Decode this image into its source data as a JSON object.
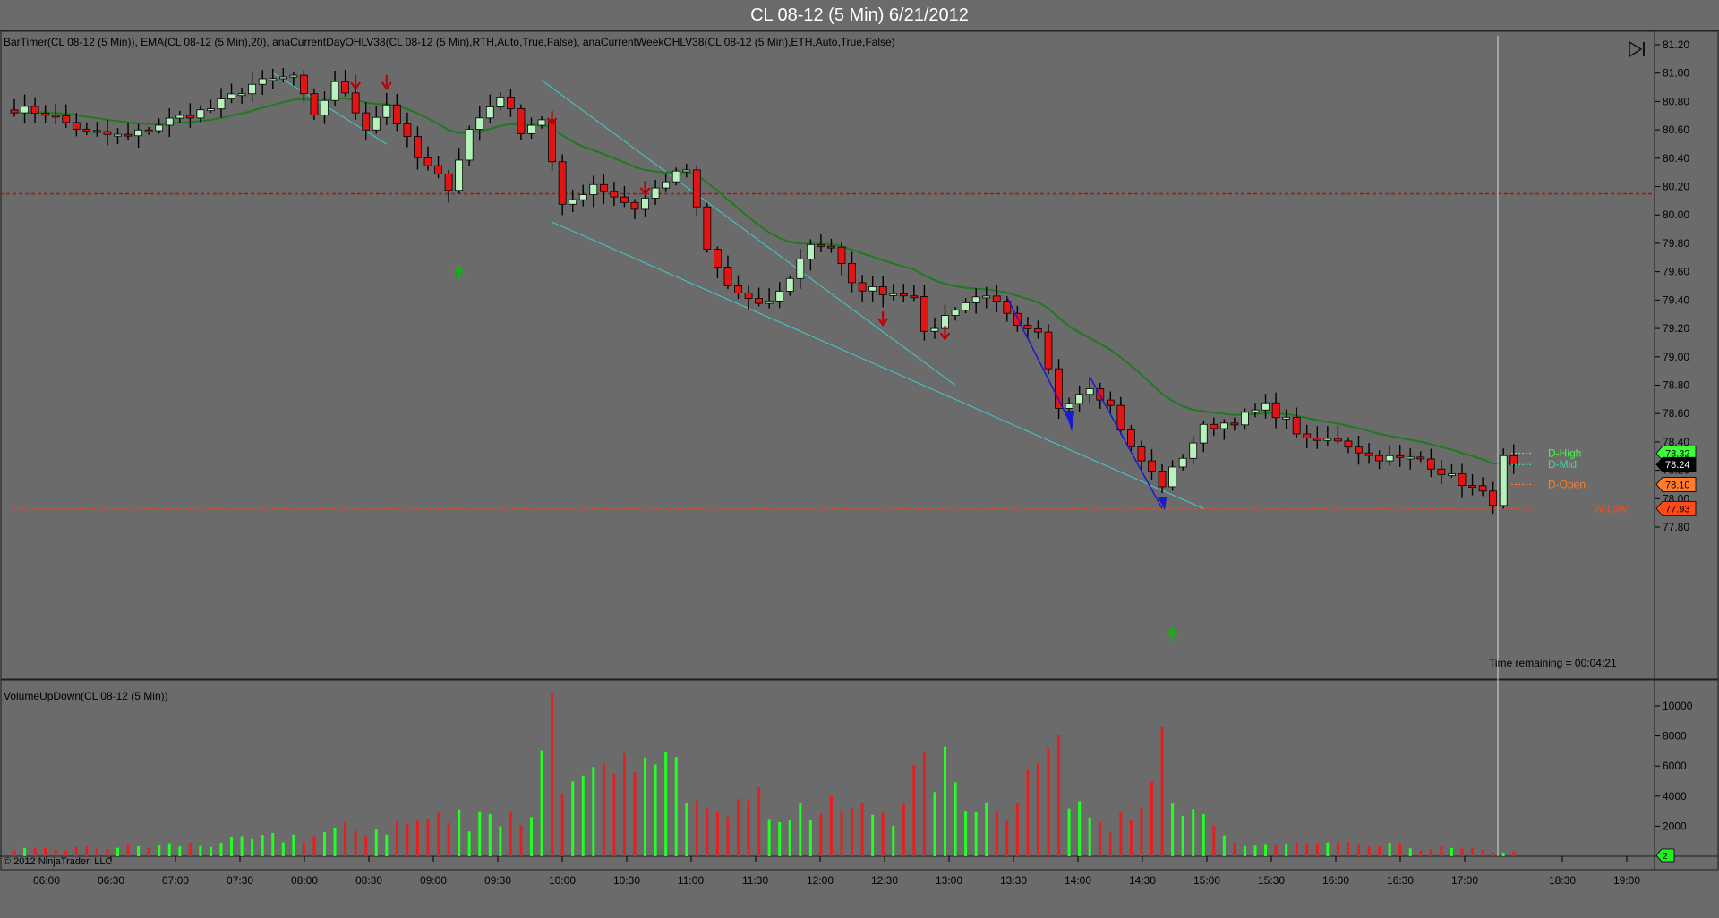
{
  "window": {
    "title": "CL 08-12 (5 Min)  6/21/2012"
  },
  "indicators": {
    "label": "BarTimer(CL  08-12  (5  Min)),  EMA(CL  08-12  (5  Min),20),  anaCurrentDayOHLV38(CL  08-12  (5  Min),RTH,Auto,True,False),  anaCurrentWeekOHLV38(CL  08-12  (5  Min),ETH,Auto,True,False)",
    "volume_label": "VolumeUpDown(CL 08-12 (5 Min))"
  },
  "timer": {
    "text": "Time remaining = 00:04:21"
  },
  "copyright": "© 2012 NinjaTrader, LLC",
  "colors": {
    "up": "#b7f2bd",
    "down": "#e31414",
    "ema": "#1e7a1e",
    "channel": "#3ecece",
    "vol_up": "#22ff22",
    "vol_down": "#e62020",
    "bg": "#6b6b6b",
    "level_red": "#b01010",
    "w_low": "#ff4a1a"
  },
  "levels": [
    {
      "name": "D-High",
      "value": 78.32,
      "tag": "78.32",
      "color": "#3bff3b"
    },
    {
      "name": "D-Mid",
      "value": 78.24,
      "tag": "78.24",
      "color": "#3fd8a8"
    },
    {
      "name": "D-Open",
      "value": 78.1,
      "tag": "78.10",
      "color": "#ff7b2e"
    },
    {
      "name": "W-Low",
      "value": 77.93,
      "tag": "77.93",
      "color": "#ff4a1a"
    }
  ],
  "chart_data": {
    "type": "candlestick",
    "title": "CL 08-12 (5 Min)  6/21/2012",
    "price_axis": {
      "ticks": [
        "81.20",
        "81.00",
        "80.80",
        "80.60",
        "80.40",
        "80.20",
        "80.00",
        "79.80",
        "79.60",
        "79.40",
        "79.20",
        "79.00",
        "78.80",
        "78.60",
        "78.40",
        "78.20",
        "78.00",
        "77.80"
      ],
      "range": [
        77.72,
        81.3
      ]
    },
    "volume_axis": {
      "ticks": [
        "10000",
        "8000",
        "6000",
        "4000",
        "2000"
      ],
      "range": [
        0,
        11500
      ]
    },
    "time_axis": [
      "06:00",
      "06:30",
      "07:00",
      "07:30",
      "08:00",
      "08:30",
      "09:00",
      "09:30",
      "10:00",
      "10:30",
      "11:00",
      "11:30",
      "12:00",
      "12:30",
      "13:00",
      "13:30",
      "14:00",
      "14:30",
      "15:00",
      "15:30",
      "16:00",
      "16:30",
      "17:00",
      "18:30",
      "19:00"
    ],
    "red_dashed_level": 80.15,
    "w_low_level": 77.93,
    "anchors": [
      {
        "b": 0,
        "p": 80.75
      },
      {
        "b": 3,
        "p": 80.72
      },
      {
        "b": 7,
        "p": 80.58
      },
      {
        "b": 11,
        "p": 80.55
      },
      {
        "b": 15,
        "p": 80.67
      },
      {
        "b": 19,
        "p": 80.75
      },
      {
        "b": 23,
        "p": 80.92
      },
      {
        "b": 27,
        "p": 80.98
      },
      {
        "b": 29,
        "p": 80.68
      },
      {
        "b": 31,
        "p": 80.95
      },
      {
        "b": 34,
        "p": 80.62
      },
      {
        "b": 36,
        "p": 80.78
      },
      {
        "b": 39,
        "p": 80.4
      },
      {
        "b": 42,
        "p": 80.2
      },
      {
        "b": 44,
        "p": 80.6
      },
      {
        "b": 47,
        "p": 80.85
      },
      {
        "b": 49,
        "p": 80.6
      },
      {
        "b": 51,
        "p": 80.68
      },
      {
        "b": 53,
        "p": 80.05
      },
      {
        "b": 56,
        "p": 80.22
      },
      {
        "b": 60,
        "p": 80.05
      },
      {
        "b": 63,
        "p": 80.25
      },
      {
        "b": 65,
        "p": 80.32
      },
      {
        "b": 67,
        "p": 79.75
      },
      {
        "b": 69,
        "p": 79.5
      },
      {
        "b": 72,
        "p": 79.35
      },
      {
        "b": 74,
        "p": 79.45
      },
      {
        "b": 77,
        "p": 79.8
      },
      {
        "b": 79,
        "p": 79.78
      },
      {
        "b": 81,
        "p": 79.5
      },
      {
        "b": 85,
        "p": 79.45
      },
      {
        "b": 87,
        "p": 79.45
      },
      {
        "b": 88,
        "p": 79.15
      },
      {
        "b": 91,
        "p": 79.35
      },
      {
        "b": 94,
        "p": 79.45
      },
      {
        "b": 97,
        "p": 79.2
      },
      {
        "b": 99,
        "p": 79.15
      },
      {
        "b": 101,
        "p": 78.65
      },
      {
        "b": 104,
        "p": 78.8
      },
      {
        "b": 106,
        "p": 78.65
      },
      {
        "b": 108,
        "p": 78.35
      },
      {
        "b": 111,
        "p": 78.1
      },
      {
        "b": 113,
        "p": 78.3
      },
      {
        "b": 115,
        "p": 78.5
      },
      {
        "b": 118,
        "p": 78.55
      },
      {
        "b": 121,
        "p": 78.65
      },
      {
        "b": 123,
        "p": 78.55
      },
      {
        "b": 125,
        "p": 78.4
      },
      {
        "b": 128,
        "p": 78.42
      },
      {
        "b": 131,
        "p": 78.3
      },
      {
        "b": 134,
        "p": 78.28
      },
      {
        "b": 136,
        "p": 78.28
      },
      {
        "b": 139,
        "p": 78.15
      },
      {
        "b": 141,
        "p": 78.08
      },
      {
        "b": 143,
        "p": 77.98
      },
      {
        "b": 144,
        "p": 78.28
      },
      {
        "b": 145,
        "p": 78.24
      }
    ],
    "volume_anchors": [
      {
        "b": 0,
        "v": 400
      },
      {
        "b": 20,
        "v": 900
      },
      {
        "b": 30,
        "v": 1600
      },
      {
        "b": 40,
        "v": 2500
      },
      {
        "b": 45,
        "v": 3000
      },
      {
        "b": 50,
        "v": 2600
      },
      {
        "b": 52,
        "v": 10900
      },
      {
        "b": 53,
        "v": 4200
      },
      {
        "b": 60,
        "v": 5600
      },
      {
        "b": 64,
        "v": 6600
      },
      {
        "b": 70,
        "v": 3800
      },
      {
        "b": 80,
        "v": 3000
      },
      {
        "b": 86,
        "v": 3500
      },
      {
        "b": 88,
        "v": 7000
      },
      {
        "b": 95,
        "v": 3000
      },
      {
        "b": 100,
        "v": 7200
      },
      {
        "b": 105,
        "v": 2300
      },
      {
        "b": 110,
        "v": 5000
      },
      {
        "b": 111,
        "v": 8600
      },
      {
        "b": 112,
        "v": 3500
      },
      {
        "b": 118,
        "v": 900
      },
      {
        "b": 130,
        "v": 800
      },
      {
        "b": 145,
        "v": 300
      }
    ],
    "arrows": [
      {
        "b": 33,
        "dir": "down"
      },
      {
        "b": 36,
        "dir": "down"
      },
      {
        "b": 43,
        "dir": "up"
      },
      {
        "b": 52,
        "dir": "down"
      },
      {
        "b": 61,
        "dir": "down"
      },
      {
        "b": 84,
        "dir": "down"
      },
      {
        "b": 90,
        "dir": "down"
      },
      {
        "b": 112,
        "dir": "up"
      }
    ]
  }
}
